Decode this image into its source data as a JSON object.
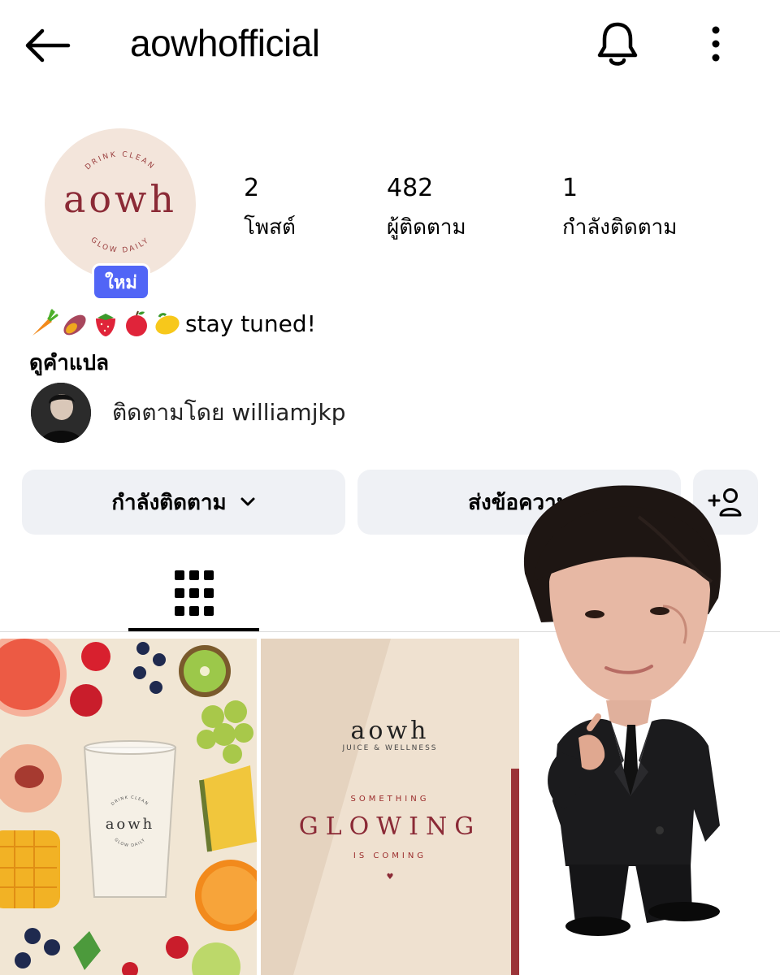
{
  "header": {
    "username": "aowhofficial",
    "back_icon": "arrow-left-icon",
    "bell_icon": "bell-icon",
    "more_icon": "more-vertical-icon"
  },
  "profile": {
    "avatar_text": "aowh",
    "avatar_ring_top": "DRINK CLEAN",
    "avatar_ring_bottom": "GLOW DAILY",
    "new_badge": "ใหม่",
    "stats": {
      "posts": {
        "value": "2",
        "label": "โพสต์"
      },
      "followers": {
        "value": "482",
        "label": "ผู้ติดตาม"
      },
      "following": {
        "value": "1",
        "label": "กำลังติดตาม"
      }
    },
    "bio_emojis": [
      "carrot",
      "sweet-potato",
      "strawberry",
      "apple",
      "lemon"
    ],
    "bio_text": "stay tuned!",
    "translate_link": "ดูคำแปล",
    "followed_by": "ติดตามโดย williamjkp"
  },
  "actions": {
    "following_button": "กำลังติดตาม",
    "message_button": "ส่งข้อความ",
    "add_user_icon": "add-person-icon"
  },
  "tabs": {
    "grid_icon": "grid-icon"
  },
  "posts": [
    {
      "cup_text": "aowh",
      "cup_ring_top": "DRINK CLEAN",
      "cup_ring_bottom": "GLOW DAILY"
    },
    {
      "brand": "aowh",
      "subtitle": "JUICE & WELLNESS",
      "line1": "SOMETHING",
      "headline": "GLOWING",
      "line2": "IS COMING",
      "heart": "♥"
    }
  ],
  "colors": {
    "badge_blue": "#5165f6",
    "button_bg": "#eff1f5",
    "brand_maroon": "#8b2a36"
  }
}
